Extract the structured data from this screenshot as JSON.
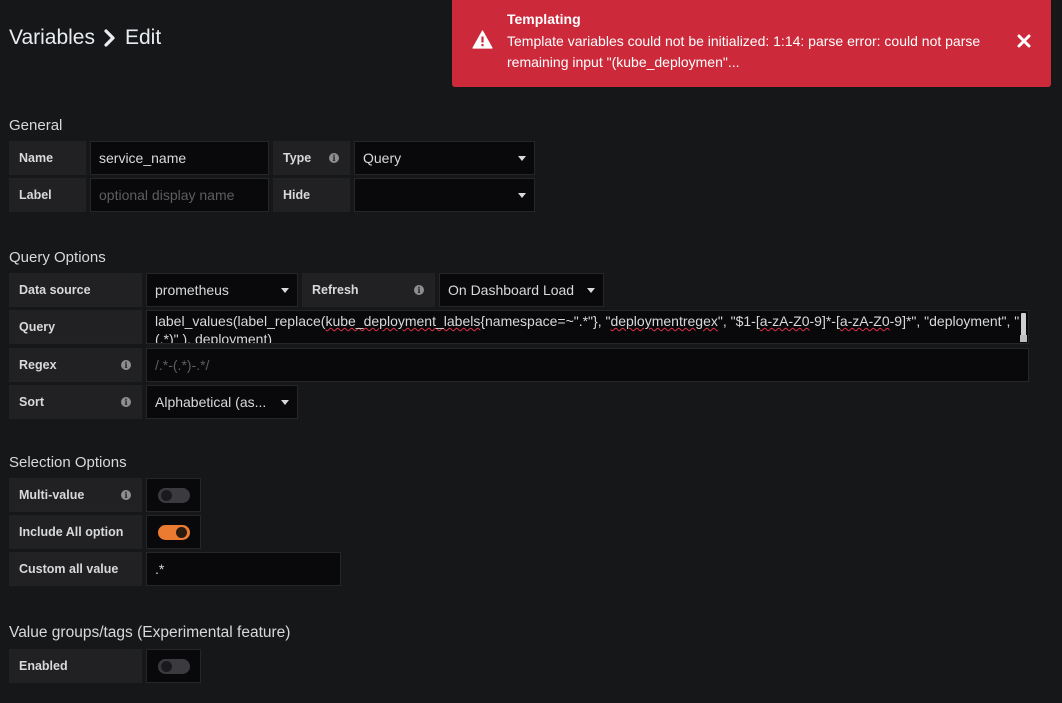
{
  "breadcrumb": {
    "root": "Variables",
    "current": "Edit"
  },
  "toast": {
    "title": "Templating",
    "message": "Template variables could not be initialized: 1:14: parse error: could not parse remaining input \"(kube_deploymen\"...",
    "color": "#cc2a3b"
  },
  "general": {
    "title": "General",
    "name_label": "Name",
    "name_value": "service_name",
    "type_label": "Type",
    "type_value": "Query",
    "label_label": "Label",
    "label_placeholder": "optional display name",
    "hide_label": "Hide",
    "hide_value": ""
  },
  "query_options": {
    "title": "Query Options",
    "datasource_label": "Data source",
    "datasource_value": "prometheus",
    "refresh_label": "Refresh",
    "refresh_value": "On Dashboard Load",
    "query_label": "Query",
    "query_parts": {
      "p1": "label_values(label_replace(",
      "p2": "kube_deployment_labels",
      "p3": "{namespace=~\".*\"}, \"",
      "p4": "deploymentregex",
      "p5": "\", \"$1-[",
      "p6": "a-zA-Z0",
      "p7": "-9]*-[",
      "p8": "a-zA-Z0",
      "p9": "-9]*\", \"deployment\", \"",
      "line2": "(.*)\" ), deployment)"
    },
    "regex_label": "Regex",
    "regex_placeholder": "/.*-(.*)-.*/",
    "sort_label": "Sort",
    "sort_value": "Alphabetical (as..."
  },
  "selection_options": {
    "title": "Selection Options",
    "multi_label": "Multi-value",
    "multi_on": false,
    "include_all_label": "Include All option",
    "include_all_on": true,
    "custom_all_label": "Custom all value",
    "custom_all_value": ".*"
  },
  "value_groups": {
    "title": "Value groups/tags (Experimental feature)",
    "enabled_label": "Enabled",
    "enabled_on": false
  },
  "colors": {
    "accent": "#eb7b30",
    "background": "#161719",
    "label_bg": "#212124",
    "input_bg": "#09090b"
  },
  "icons": {
    "breadcrumb_sep": "chevron-right-icon",
    "toast_warn": "warning-icon",
    "toast_close": "close-icon",
    "info": "info-icon",
    "caret": "caret-down-icon"
  }
}
